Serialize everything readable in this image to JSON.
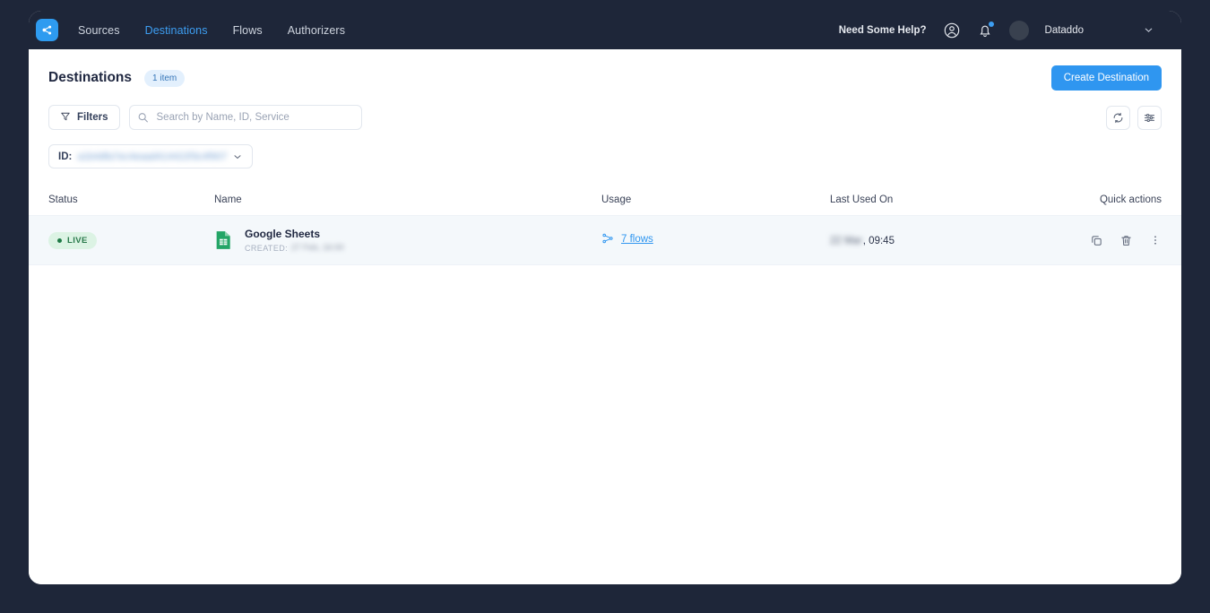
{
  "nav": {
    "logo_icon": "dataddo-nodes-logo-icon",
    "links": [
      {
        "label": "Sources",
        "active": false
      },
      {
        "label": "Destinations",
        "active": true
      },
      {
        "label": "Flows",
        "active": false
      },
      {
        "label": "Authorizers",
        "active": false
      }
    ],
    "help_label": "Need Some Help?",
    "account_icon": "user-circle-icon",
    "notifications_icon": "bell-icon",
    "avatar_icon": "avatar",
    "user_name": "Dataddo",
    "caret_icon": "chevron-down-icon"
  },
  "header": {
    "title": "Destinations",
    "count_badge": "1 item",
    "create_button": "Create Destination"
  },
  "toolbar": {
    "filters_label": "Filters",
    "filters_icon": "funnel-icon",
    "search_placeholder": "Search by Name, ID, Service",
    "search_value": "",
    "search_icon": "search-icon",
    "refresh_icon": "refresh-icon",
    "settings_icon": "sliders-icon"
  },
  "filter_chips": [
    {
      "label": "ID:",
      "value": "a1b4dfa7ec4eaad414422f3c4f907",
      "redacted": true,
      "caret_icon": "chevron-down-icon"
    }
  ],
  "table": {
    "columns": [
      "Status",
      "Name",
      "Usage",
      "Last Used On",
      "Quick actions"
    ],
    "rows": [
      {
        "status": "LIVE",
        "service_icon": "google-sheets-icon",
        "name": "Google Sheets",
        "created_label": "CREATED:",
        "created_value": "27 Feb, 16:00",
        "usage_icon": "flows-branch-icon",
        "usage_label": "7 flows",
        "last_used_date": "22 Mar",
        "last_used_time": ", 09:45",
        "actions": [
          {
            "icon": "duplicate-icon"
          },
          {
            "icon": "trash-icon"
          },
          {
            "icon": "more-vertical-icon"
          }
        ]
      }
    ]
  },
  "colors": {
    "page_background": "#1e2639",
    "navbar": "#1e2639",
    "accent": "#2f96f0",
    "active_link": "#3d9ef2",
    "live_badge_bg": "#dcf3e4",
    "live_badge_text": "#2a7a4c",
    "row_background": "#f4f8fb",
    "badge_bg": "#e3f0fd"
  }
}
